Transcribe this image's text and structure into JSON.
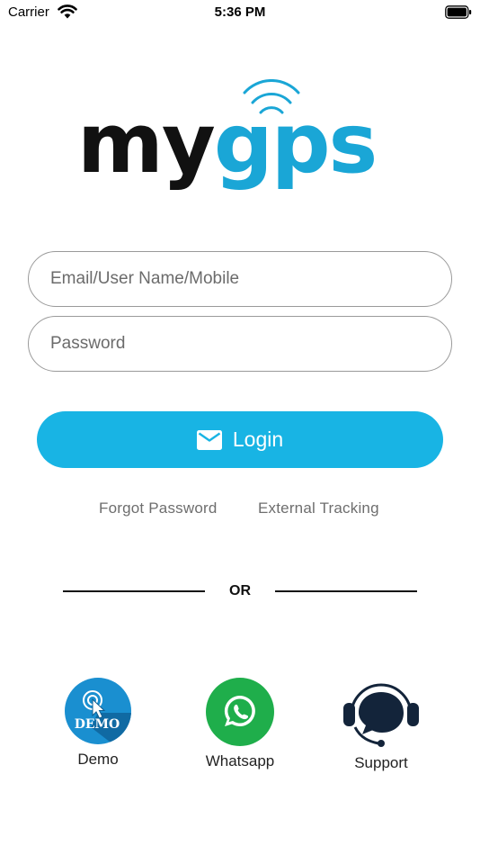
{
  "status_bar": {
    "carrier": "Carrier",
    "time": "5:36 PM"
  },
  "logo": {
    "part_dark": "my",
    "part_accent": "gps",
    "dark_color": "#111111",
    "accent_color": "#1aa6d6"
  },
  "login_form": {
    "email_placeholder": "Email/User Name/Mobile",
    "password_placeholder": "Password",
    "login_label": "Login",
    "login_icon": "mail-icon",
    "button_color": "#18b4e4"
  },
  "links": {
    "forgot_password": "Forgot Password",
    "external_tracking": "External Tracking"
  },
  "divider": {
    "label": "OR"
  },
  "actions": [
    {
      "label": "Demo",
      "icon": "demo-icon",
      "badge": "DEMO",
      "color": "#1a8fd0"
    },
    {
      "label": "Whatsapp",
      "icon": "whatsapp-icon",
      "color": "#1fae4b"
    },
    {
      "label": "Support",
      "icon": "headset-icon",
      "color": "#13243a"
    }
  ]
}
